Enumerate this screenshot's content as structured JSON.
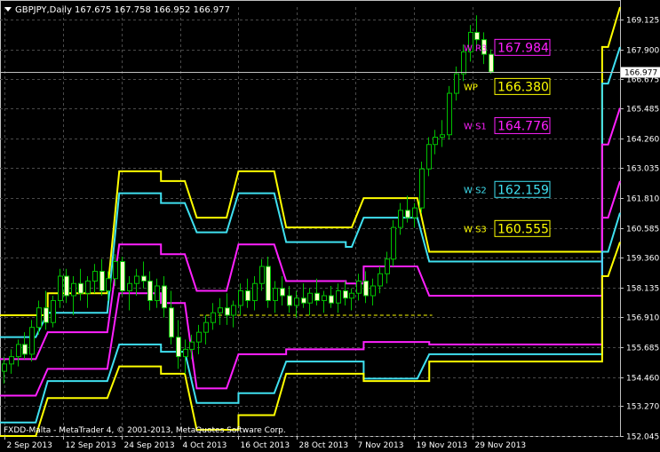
{
  "header": {
    "symbol": "GBPJPY,Daily",
    "ohlc": "167.675 167.758 166.952 166.977"
  },
  "footer": {
    "copyright": "FXDD-Malta - MetaTrader 4, © 2001-2013, MetaQuotes Software Corp."
  },
  "colors": {
    "background": "#000000",
    "grid": "#4a4a4a",
    "axis": "#c0c0c0",
    "yellow": "#ffff00",
    "cyan": "#3fe0f0",
    "magenta": "#ff20ff",
    "candle_up": "#000000",
    "candle_down": "#ffffcc",
    "wick": "#00c000",
    "dashed": "#ffff00"
  },
  "chart_data": {
    "type": "candlestick",
    "title": "GBPJPY,Daily",
    "ylim": [
      152.045,
      169.635
    ],
    "y_ticks": [
      "169.125",
      "167.900",
      "166.675",
      "165.485",
      "164.260",
      "163.035",
      "161.810",
      "160.585",
      "159.360",
      "158.135",
      "156.910",
      "155.685",
      "154.460",
      "153.270",
      "152.045"
    ],
    "x_ticks": [
      "2 Sep 2013",
      "12 Sep 2013",
      "24 Sep 2013",
      "4 Oct 2013",
      "16 Oct 2013",
      "28 Oct 2013",
      "7 Nov 2013",
      "19 Nov 2013",
      "29 Nov 2013"
    ],
    "current_price": "166.977",
    "levels": [
      {
        "tag": "W R3",
        "value": "167.984",
        "color": "magenta",
        "price": 167.984
      },
      {
        "tag": "WP",
        "value": "166.380",
        "color": "yellow",
        "price": 166.38
      },
      {
        "tag": "W S1",
        "value": "164.776",
        "color": "magenta",
        "price": 164.776
      },
      {
        "tag": "W S2",
        "value": "162.159",
        "color": "cyan",
        "price": 162.159
      },
      {
        "tag": "W S3",
        "value": "160.555",
        "color": "yellow",
        "price": 160.555
      }
    ],
    "series": [
      {
        "color": "yellow",
        "steps": [
          [
            0,
            157.0
          ],
          [
            7,
            157.0
          ],
          [
            8,
            157.9
          ],
          [
            20,
            162.9
          ],
          [
            27,
            162.5
          ],
          [
            33,
            161.0
          ],
          [
            37,
            161.0
          ],
          [
            40,
            162.9
          ],
          [
            46,
            162.9
          ],
          [
            48,
            160.6
          ],
          [
            58,
            160.6
          ],
          [
            61,
            161.8
          ],
          [
            69,
            161.8
          ],
          [
            72,
            159.6
          ],
          [
            100,
            159.6
          ],
          [
            101,
            168.0
          ],
          [
            104,
            169.635
          ]
        ]
      },
      {
        "color": "cyan",
        "steps": [
          [
            0,
            156.1
          ],
          [
            6,
            156.1
          ],
          [
            8,
            157.1
          ],
          [
            20,
            162.0
          ],
          [
            27,
            161.6
          ],
          [
            33,
            160.4
          ],
          [
            37,
            160.4
          ],
          [
            40,
            162.0
          ],
          [
            46,
            162.0
          ],
          [
            48,
            160.0
          ],
          [
            58,
            159.8
          ],
          [
            61,
            161.0
          ],
          [
            69,
            161.0
          ],
          [
            72,
            159.2
          ],
          [
            100,
            159.2
          ],
          [
            101,
            166.5
          ],
          [
            104,
            168.0
          ]
        ]
      },
      {
        "color": "magenta",
        "steps": [
          [
            0,
            155.2
          ],
          [
            6,
            155.2
          ],
          [
            8,
            156.3
          ],
          [
            20,
            159.9
          ],
          [
            27,
            159.5
          ],
          [
            33,
            158.0
          ],
          [
            37,
            158.0
          ],
          [
            40,
            159.9
          ],
          [
            46,
            159.9
          ],
          [
            48,
            158.4
          ],
          [
            58,
            158.3
          ],
          [
            61,
            159.0
          ],
          [
            69,
            159.0
          ],
          [
            72,
            157.8
          ],
          [
            100,
            157.8
          ],
          [
            101,
            164.0
          ],
          [
            104,
            165.5
          ]
        ]
      },
      {
        "color": "magenta",
        "steps": [
          [
            0,
            153.7
          ],
          [
            6,
            153.7
          ],
          [
            8,
            154.8
          ],
          [
            20,
            157.9
          ],
          [
            27,
            157.5
          ],
          [
            33,
            154.0
          ],
          [
            37,
            154.0
          ],
          [
            40,
            155.4
          ],
          [
            46,
            155.4
          ],
          [
            48,
            155.6
          ],
          [
            58,
            155.6
          ],
          [
            61,
            155.9
          ],
          [
            69,
            155.9
          ],
          [
            72,
            155.8
          ],
          [
            100,
            155.8
          ],
          [
            101,
            161.0
          ],
          [
            104,
            162.5
          ]
        ]
      },
      {
        "color": "cyan",
        "steps": [
          [
            0,
            152.6
          ],
          [
            6,
            152.6
          ],
          [
            8,
            154.3
          ],
          [
            20,
            155.8
          ],
          [
            27,
            155.5
          ],
          [
            33,
            153.4
          ],
          [
            37,
            153.4
          ],
          [
            40,
            153.8
          ],
          [
            46,
            153.8
          ],
          [
            48,
            155.1
          ],
          [
            58,
            155.1
          ],
          [
            61,
            154.4
          ],
          [
            69,
            154.4
          ],
          [
            72,
            155.4
          ],
          [
            100,
            155.4
          ],
          [
            101,
            159.6
          ],
          [
            104,
            161.2
          ]
        ]
      },
      {
        "color": "yellow",
        "steps": [
          [
            0,
            152.045
          ],
          [
            6,
            152.045
          ],
          [
            8,
            153.6
          ],
          [
            20,
            154.9
          ],
          [
            27,
            154.6
          ],
          [
            33,
            152.3
          ],
          [
            37,
            152.3
          ],
          [
            40,
            152.9
          ],
          [
            46,
            152.9
          ],
          [
            48,
            154.6
          ],
          [
            58,
            154.6
          ],
          [
            61,
            154.3
          ],
          [
            69,
            154.3
          ],
          [
            72,
            155.1
          ],
          [
            100,
            155.1
          ],
          [
            101,
            158.6
          ],
          [
            104,
            160.0
          ]
        ]
      }
    ],
    "candles": [
      {
        "o": 154.7,
        "h": 155.3,
        "l": 154.2,
        "c": 155.0
      },
      {
        "o": 155.0,
        "h": 155.6,
        "l": 154.6,
        "c": 155.3
      },
      {
        "o": 155.3,
        "h": 156.0,
        "l": 154.9,
        "c": 155.8
      },
      {
        "o": 155.8,
        "h": 156.3,
        "l": 155.2,
        "c": 155.4
      },
      {
        "o": 155.4,
        "h": 156.8,
        "l": 155.1,
        "c": 156.5
      },
      {
        "o": 156.5,
        "h": 157.6,
        "l": 156.2,
        "c": 157.3
      },
      {
        "o": 157.3,
        "h": 158.0,
        "l": 156.4,
        "c": 156.7
      },
      {
        "o": 156.7,
        "h": 157.8,
        "l": 156.5,
        "c": 157.6
      },
      {
        "o": 157.6,
        "h": 158.9,
        "l": 157.3,
        "c": 158.6
      },
      {
        "o": 158.6,
        "h": 158.9,
        "l": 157.5,
        "c": 157.8
      },
      {
        "o": 157.8,
        "h": 158.6,
        "l": 157.0,
        "c": 158.3
      },
      {
        "o": 158.3,
        "h": 158.9,
        "l": 157.6,
        "c": 157.9
      },
      {
        "o": 157.9,
        "h": 158.6,
        "l": 157.3,
        "c": 158.4
      },
      {
        "o": 158.4,
        "h": 159.1,
        "l": 157.9,
        "c": 158.8
      },
      {
        "o": 158.8,
        "h": 159.3,
        "l": 157.8,
        "c": 158.0
      },
      {
        "o": 158.0,
        "h": 158.8,
        "l": 157.6,
        "c": 158.5
      },
      {
        "o": 158.5,
        "h": 159.5,
        "l": 158.2,
        "c": 159.2
      },
      {
        "o": 159.2,
        "h": 159.4,
        "l": 157.8,
        "c": 158.0
      },
      {
        "o": 158.0,
        "h": 158.6,
        "l": 157.2,
        "c": 158.3
      },
      {
        "o": 158.3,
        "h": 158.9,
        "l": 157.8,
        "c": 158.6
      },
      {
        "o": 158.6,
        "h": 159.2,
        "l": 158.1,
        "c": 158.4
      },
      {
        "o": 158.4,
        "h": 158.8,
        "l": 157.2,
        "c": 157.6
      },
      {
        "o": 157.6,
        "h": 158.5,
        "l": 157.3,
        "c": 158.2
      },
      {
        "o": 158.2,
        "h": 158.6,
        "l": 156.9,
        "c": 157.3
      },
      {
        "o": 157.3,
        "h": 158.0,
        "l": 155.8,
        "c": 156.1
      },
      {
        "o": 156.1,
        "h": 156.8,
        "l": 154.8,
        "c": 155.3
      },
      {
        "o": 155.3,
        "h": 156.0,
        "l": 154.6,
        "c": 155.6
      },
      {
        "o": 155.6,
        "h": 156.2,
        "l": 155.2,
        "c": 155.9
      },
      {
        "o": 155.9,
        "h": 156.6,
        "l": 155.4,
        "c": 156.3
      },
      {
        "o": 156.3,
        "h": 157.0,
        "l": 155.8,
        "c": 156.7
      },
      {
        "o": 156.7,
        "h": 157.5,
        "l": 156.4,
        "c": 157.1
      },
      {
        "o": 157.1,
        "h": 157.7,
        "l": 156.6,
        "c": 157.3
      },
      {
        "o": 157.3,
        "h": 157.9,
        "l": 156.6,
        "c": 157.0
      },
      {
        "o": 157.0,
        "h": 157.6,
        "l": 156.5,
        "c": 157.4
      },
      {
        "o": 157.4,
        "h": 158.3,
        "l": 157.0,
        "c": 158.0
      },
      {
        "o": 158.0,
        "h": 158.5,
        "l": 157.3,
        "c": 157.6
      },
      {
        "o": 157.6,
        "h": 158.6,
        "l": 157.2,
        "c": 158.3
      },
      {
        "o": 158.3,
        "h": 159.3,
        "l": 158.0,
        "c": 159.0
      },
      {
        "o": 159.0,
        "h": 159.4,
        "l": 157.3,
        "c": 157.6
      },
      {
        "o": 157.6,
        "h": 158.4,
        "l": 157.1,
        "c": 158.1
      },
      {
        "o": 158.1,
        "h": 158.6,
        "l": 157.4,
        "c": 157.8
      },
      {
        "o": 157.8,
        "h": 158.2,
        "l": 157.1,
        "c": 157.4
      },
      {
        "o": 157.4,
        "h": 158.0,
        "l": 156.9,
        "c": 157.7
      },
      {
        "o": 157.7,
        "h": 158.3,
        "l": 157.3,
        "c": 157.5
      },
      {
        "o": 157.5,
        "h": 158.1,
        "l": 157.0,
        "c": 157.9
      },
      {
        "o": 157.9,
        "h": 158.5,
        "l": 157.4,
        "c": 157.6
      },
      {
        "o": 157.6,
        "h": 158.0,
        "l": 157.1,
        "c": 157.8
      },
      {
        "o": 157.8,
        "h": 158.2,
        "l": 157.3,
        "c": 157.5
      },
      {
        "o": 157.5,
        "h": 158.3,
        "l": 157.1,
        "c": 158.0
      },
      {
        "o": 158.0,
        "h": 158.4,
        "l": 157.4,
        "c": 157.7
      },
      {
        "o": 157.7,
        "h": 158.1,
        "l": 157.2,
        "c": 157.9
      },
      {
        "o": 157.9,
        "h": 158.7,
        "l": 157.6,
        "c": 158.4
      },
      {
        "o": 158.4,
        "h": 158.8,
        "l": 157.5,
        "c": 157.8
      },
      {
        "o": 157.8,
        "h": 158.5,
        "l": 157.4,
        "c": 158.2
      },
      {
        "o": 158.2,
        "h": 159.0,
        "l": 157.9,
        "c": 158.7
      },
      {
        "o": 158.7,
        "h": 159.6,
        "l": 158.3,
        "c": 159.3
      },
      {
        "o": 159.3,
        "h": 160.9,
        "l": 159.0,
        "c": 160.6
      },
      {
        "o": 160.6,
        "h": 161.6,
        "l": 160.3,
        "c": 161.3
      },
      {
        "o": 161.3,
        "h": 161.9,
        "l": 160.8,
        "c": 161.0
      },
      {
        "o": 161.0,
        "h": 161.6,
        "l": 160.6,
        "c": 161.4
      },
      {
        "o": 161.4,
        "h": 163.3,
        "l": 161.2,
        "c": 163.0
      },
      {
        "o": 163.0,
        "h": 164.3,
        "l": 162.7,
        "c": 164.0
      },
      {
        "o": 164.0,
        "h": 164.6,
        "l": 163.6,
        "c": 164.3
      },
      {
        "o": 164.3,
        "h": 165.0,
        "l": 163.9,
        "c": 164.4
      },
      {
        "o": 164.4,
        "h": 166.4,
        "l": 164.2,
        "c": 166.1
      },
      {
        "o": 166.1,
        "h": 167.2,
        "l": 165.8,
        "c": 166.9
      },
      {
        "o": 166.9,
        "h": 168.1,
        "l": 166.6,
        "c": 167.8
      },
      {
        "o": 167.8,
        "h": 168.9,
        "l": 167.4,
        "c": 168.6
      },
      {
        "o": 168.6,
        "h": 169.3,
        "l": 168.0,
        "c": 168.3
      },
      {
        "o": 168.3,
        "h": 168.6,
        "l": 167.3,
        "c": 167.7
      },
      {
        "o": 167.7,
        "h": 167.9,
        "l": 166.9,
        "c": 166.977
      }
    ]
  }
}
